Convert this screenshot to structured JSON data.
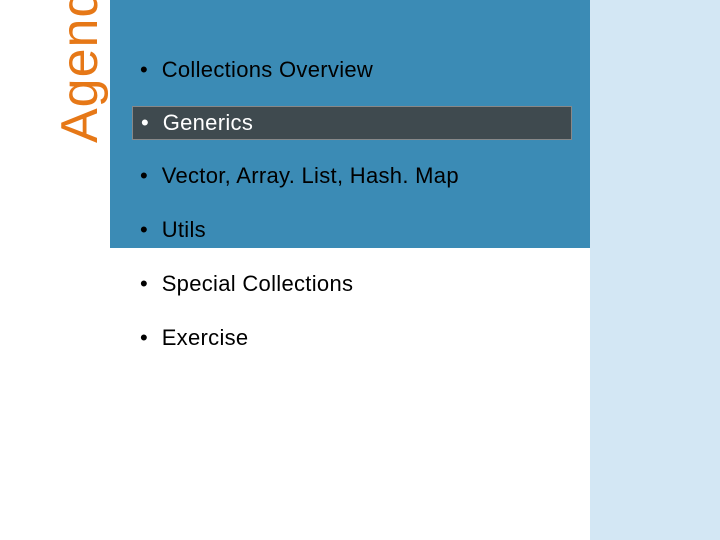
{
  "title": "Agenda",
  "bullets": [
    {
      "label": "Collections Overview",
      "highlighted": false
    },
    {
      "label": "Generics",
      "highlighted": true
    },
    {
      "label": "Vector, Array. List, Hash. Map",
      "highlighted": false
    },
    {
      "label": "Utils",
      "highlighted": false
    },
    {
      "label": "Special Collections",
      "highlighted": false
    },
    {
      "label": "Exercise",
      "highlighted": false
    }
  ],
  "colors": {
    "accent_blue": "#3b8bb5",
    "light_blue": "#d3e7f4",
    "title_orange": "#e67817",
    "highlight_bg": "#3f4a4f"
  }
}
